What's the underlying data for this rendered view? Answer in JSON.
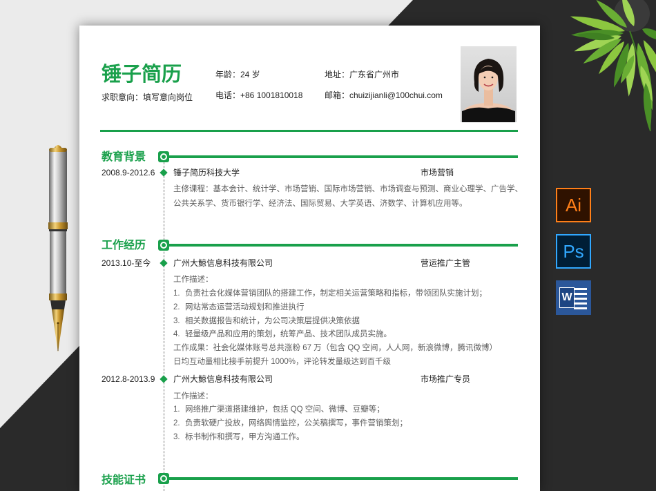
{
  "colors": {
    "accent_green": "#19a04b",
    "text_dark": "#222222",
    "text_gray": "#5c5c5c",
    "backdrop_light": "#ebebeb",
    "backdrop_dark": "#2a2a2a",
    "illustrator_orange": "#ff7f18",
    "photoshop_blue": "#31a8ff",
    "word_blue": "#2b579a"
  },
  "decorations": [
    "fountain-pen-icon",
    "potted-plant-icon",
    "portrait-photo"
  ],
  "resume": {
    "name": "锤子简历",
    "objective": "求职意向：填写意向岗位",
    "contact": {
      "age": "年龄：24 岁",
      "address": "地址：广东省广州市",
      "phone": "电话：+86 1001810018",
      "email": "邮箱：chuizijianli@100chui.com"
    },
    "education": {
      "title": "教育背景",
      "entries": [
        {
          "period": "2008.9-2012.6",
          "org": "锤子简历科技大学",
          "role": "市场营销",
          "lines": [
            "主修课程：基本会计、统计学、市场营销、国际市场营销、市场调查与预测、商业心理学、广告学、",
            "公共关系学、货币银行学、经济法、国际贸易、大学英语、济数学、计算机应用等。"
          ]
        }
      ]
    },
    "work": {
      "title": "工作经历",
      "entries": [
        {
          "period": "2013.10-至今",
          "org": "广州大鲸信息科技有限公司",
          "role": "营运推广主管",
          "desc_label": "工作描述：",
          "items": [
            {
              "num": "1.",
              "text": "负责社会化媒体营销团队的搭建工作，制定相关运营策略和指标，带领团队实施计划；"
            },
            {
              "num": "2.",
              "text": "网站常态运营活动规划和推进执行"
            },
            {
              "num": "3.",
              "text": "相关数据报告和统计，为公司决策层提供决策依据"
            },
            {
              "num": "4.",
              "text": "轻量级产品和应用的策划，统筹产品、技术团队成员实施。"
            }
          ],
          "results": [
            "工作成果：社会化媒体账号总共涨粉 67 万（包含 QQ 空间，人人网，新浪微博，腾讯微博）",
            "日均互动量相比接手前提升 1000%，评论转发量级达到百千级"
          ]
        },
        {
          "period": "2012.8-2013.9",
          "org": "广州大鲸信息科技有限公司",
          "role": "市场推广专员",
          "desc_label": "工作描述：",
          "items": [
            {
              "num": "1.",
              "text": "网络推广渠道搭建维护，包括 QQ 空间、微博、豆瓣等；"
            },
            {
              "num": "2.",
              "text": "负责软硬广投放，网络舆情监控，公关稿撰写，事件营销策划；"
            },
            {
              "num": "3.",
              "text": "标书制作和撰写，甲方沟通工作。"
            }
          ]
        }
      ]
    },
    "skills": {
      "title": "技能证书"
    }
  },
  "software_icons": [
    {
      "icon": "illustrator-icon",
      "label": "Ai"
    },
    {
      "icon": "photoshop-icon",
      "label": "Ps"
    },
    {
      "icon": "word-icon",
      "label": "W"
    }
  ]
}
